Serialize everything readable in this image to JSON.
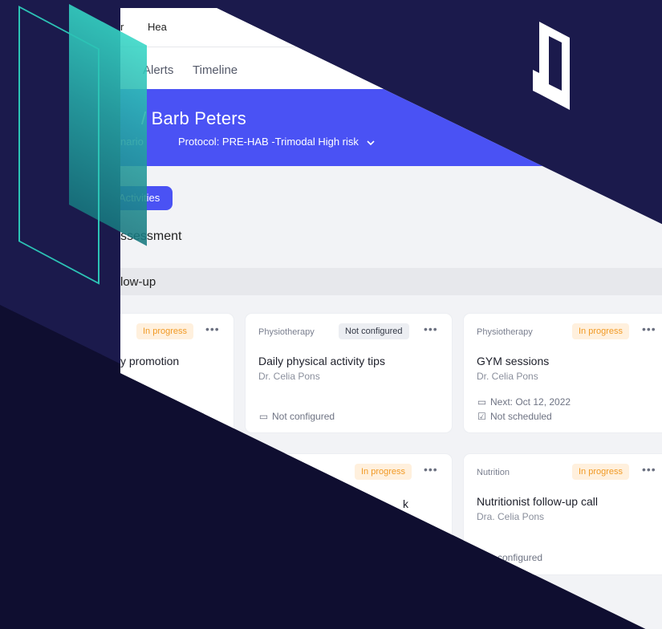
{
  "app": {
    "topbar": {
      "item1": "r",
      "item2": "Hea"
    },
    "tabs": [
      {
        "label": "Alerts"
      },
      {
        "label": "Timeline"
      }
    ],
    "patient": {
      "name": "/ Barb Peters",
      "meta_left": "nario",
      "protocol": "Protocol: PRE-HAB -Trimodal High risk"
    },
    "activities_button": "Activities",
    "assessment_heading": "ssessment",
    "followup_heading": "low-up",
    "cards": [
      {
        "category": "",
        "status": "In progress",
        "status_type": "progress",
        "title": "y promotion",
        "doctor": "",
        "lines": []
      },
      {
        "category": "Physiotherapy",
        "status": "Not configured",
        "status_type": "nc",
        "title": "Daily physical activity tips",
        "doctor": "Dr. Celia Pons",
        "lines": [
          {
            "icon": "calendar-icon",
            "text": "Not configured"
          }
        ]
      },
      {
        "category": "Physiotherapy",
        "status": "In progress",
        "status_type": "progress",
        "title": "GYM sessions",
        "doctor": "Dr. Celia Pons",
        "lines": [
          {
            "icon": "calendar-icon",
            "text": "Next: Oct 12, 2022"
          },
          {
            "icon": "calendar-check-icon",
            "text": "Not scheduled"
          }
        ]
      },
      {
        "category": "",
        "status": "In progress",
        "status_type": "progress",
        "title": "k",
        "doctor": "",
        "lines": []
      },
      {
        "category": "Nutrition",
        "status": "In progress",
        "status_type": "progress",
        "title": "Nutritionist follow-up call",
        "doctor": "Dra. Celia Pons",
        "lines": [
          {
            "icon": "",
            "text": "configured"
          }
        ]
      }
    ],
    "more_label": "•••"
  },
  "colors": {
    "background": "#1b1a4c",
    "accent": "#4a52f4",
    "teal": "#2cc3b5",
    "badge_progress_text": "#f19a25",
    "badge_progress_bg": "#fff0dd"
  }
}
